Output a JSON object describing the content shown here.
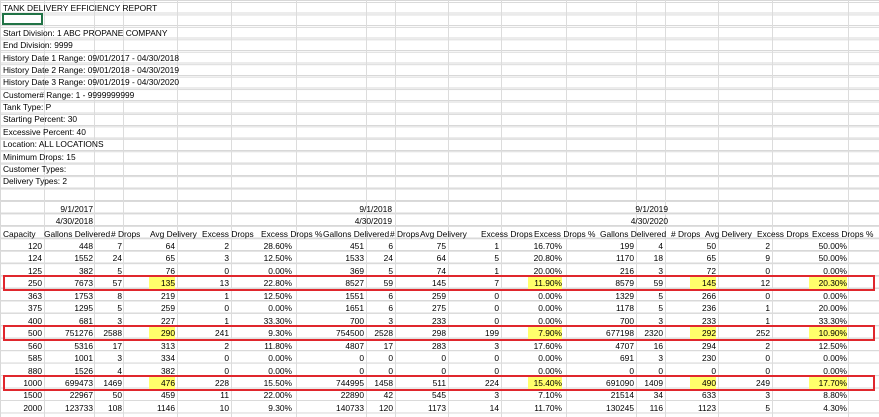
{
  "report": {
    "title": "TANK DELIVERY EFFICIENCY REPORT",
    "params": [
      "Start Division:    1 ABC PROPANE COMPANY",
      "End Division: 9999",
      "History Date 1 Range: 09/01/2017 - 04/30/2018",
      "History Date 2 Range: 09/01/2018 - 04/30/2019",
      "History Date 3 Range: 09/01/2019 - 04/30/2020",
      "Customer# Range: 1 - 9999999999",
      "Tank Type: P",
      "Starting Percent: 30",
      "Excessive Percent: 40",
      "Location: ALL LOCATIONS",
      "Minimum Drops: 15",
      "Customer Types:",
      "Delivery Types: 2"
    ]
  },
  "periods": [
    {
      "start": "9/1/2017",
      "end": "4/30/2018"
    },
    {
      "start": "9/1/2018",
      "end": "4/30/2019"
    },
    {
      "start": "9/1/2019",
      "end": "4/30/2020"
    }
  ],
  "columns": [
    "Capacity",
    "Gallons Delivered",
    "# Drops",
    "Avg Delivery",
    "Excess Drops",
    "Excess Drops %",
    "Gallons Delivered",
    "# Drops",
    "Avg Delivery",
    "Excess Drops",
    "Excess Drops %",
    "Gallons Delivered",
    "# Drops",
    "Avg Delivery",
    "Excess Drops",
    "Excess Drops %"
  ],
  "rows": [
    [
      "120",
      "448",
      "7",
      "64",
      "2",
      "28.60%",
      "451",
      "6",
      "75",
      "1",
      "16.70%",
      "199",
      "4",
      "50",
      "2",
      "50.00%"
    ],
    [
      "124",
      "1552",
      "24",
      "65",
      "3",
      "12.50%",
      "1533",
      "24",
      "64",
      "5",
      "20.80%",
      "1170",
      "18",
      "65",
      "9",
      "50.00%"
    ],
    [
      "125",
      "382",
      "5",
      "76",
      "0",
      "0.00%",
      "369",
      "5",
      "74",
      "1",
      "20.00%",
      "216",
      "3",
      "72",
      "0",
      "0.00%"
    ],
    [
      "250",
      "7673",
      "57",
      "135",
      "13",
      "22.80%",
      "8527",
      "59",
      "145",
      "7",
      "11.90%",
      "8579",
      "59",
      "145",
      "12",
      "20.30%"
    ],
    [
      "363",
      "1753",
      "8",
      "219",
      "1",
      "12.50%",
      "1551",
      "6",
      "259",
      "0",
      "0.00%",
      "1329",
      "5",
      "266",
      "0",
      "0.00%"
    ],
    [
      "375",
      "1295",
      "5",
      "259",
      "0",
      "0.00%",
      "1651",
      "6",
      "275",
      "0",
      "0.00%",
      "1178",
      "5",
      "236",
      "1",
      "20.00%"
    ],
    [
      "400",
      "681",
      "3",
      "227",
      "1",
      "33.30%",
      "700",
      "3",
      "233",
      "0",
      "0.00%",
      "700",
      "3",
      "233",
      "1",
      "33.30%"
    ],
    [
      "500",
      "751276",
      "2588",
      "290",
      "241",
      "9.30%",
      "754500",
      "2528",
      "298",
      "199",
      "7.90%",
      "677198",
      "2320",
      "292",
      "252",
      "10.90%"
    ],
    [
      "560",
      "5316",
      "17",
      "313",
      "2",
      "11.80%",
      "4807",
      "17",
      "283",
      "3",
      "17.60%",
      "4707",
      "16",
      "294",
      "2",
      "12.50%"
    ],
    [
      "585",
      "1001",
      "3",
      "334",
      "0",
      "0.00%",
      "0",
      "0",
      "0",
      "0",
      "0.00%",
      "691",
      "3",
      "230",
      "0",
      "0.00%"
    ],
    [
      "880",
      "1526",
      "4",
      "382",
      "0",
      "0.00%",
      "0",
      "0",
      "0",
      "0",
      "0.00%",
      "0",
      "0",
      "0",
      "0",
      "0.00%"
    ],
    [
      "1000",
      "699473",
      "1469",
      "476",
      "228",
      "15.50%",
      "744995",
      "1458",
      "511",
      "224",
      "15.40%",
      "691090",
      "1409",
      "490",
      "249",
      "17.70%"
    ],
    [
      "1500",
      "22967",
      "50",
      "459",
      "11",
      "22.00%",
      "22890",
      "42",
      "545",
      "3",
      "7.10%",
      "21514",
      "34",
      "633",
      "3",
      "8.80%"
    ],
    [
      "2000",
      "123733",
      "108",
      "1146",
      "10",
      "9.30%",
      "140733",
      "120",
      "1173",
      "14",
      "11.70%",
      "130245",
      "116",
      "1123",
      "5",
      "4.30%"
    ]
  ],
  "highlight_color": "#ffff6b",
  "box_color": "#e0272d"
}
